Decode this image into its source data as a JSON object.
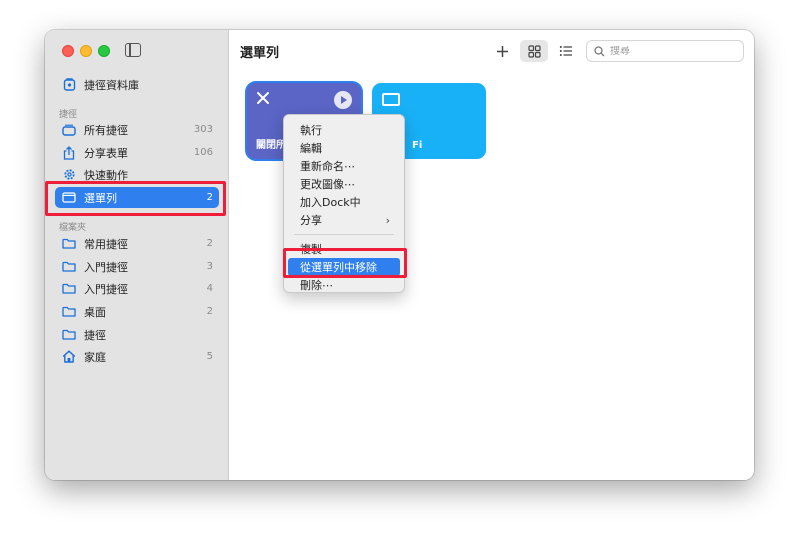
{
  "sidebar": {
    "library": {
      "label": "捷徑資料庫",
      "icon": "library-icon"
    },
    "section_shortcuts": "捷徑",
    "items": [
      {
        "label": "所有捷徑",
        "count": "303",
        "icon": "square-stack-icon"
      },
      {
        "label": "分享表單",
        "count": "106",
        "icon": "share-icon"
      },
      {
        "label": "快速動作",
        "count": "",
        "icon": "gear-icon"
      },
      {
        "label": "選單列",
        "count": "2",
        "icon": "menubar-icon",
        "selected": true
      }
    ],
    "section_folders": "檔案夾",
    "folders": [
      {
        "label": "常用捷徑",
        "count": "2",
        "icon": "folder-icon"
      },
      {
        "label": "入門捷徑",
        "count": "3",
        "icon": "folder-icon"
      },
      {
        "label": "入門捷徑",
        "count": "4",
        "icon": "folder-icon"
      },
      {
        "label": "桌面",
        "count": "2",
        "icon": "folder-icon"
      },
      {
        "label": "捷徑",
        "count": "",
        "icon": "folder-icon"
      },
      {
        "label": "家庭",
        "count": "5",
        "icon": "home-icon"
      }
    ]
  },
  "main": {
    "title": "選單列",
    "search": {
      "placeholder": "搜尋",
      "value": ""
    },
    "tiles": [
      {
        "name": "關閉所",
        "color": "#5a65c5",
        "icon": "close-icon"
      },
      {
        "name": "Fi",
        "color": "#18b1f8",
        "icon": "tv-icon"
      }
    ]
  },
  "context_menu": {
    "items": [
      {
        "label": "執行"
      },
      {
        "label": "編輯"
      },
      {
        "label": "重新命名⋯"
      },
      {
        "label": "更改圖像⋯"
      },
      {
        "label": "加入Dock中"
      },
      {
        "label": "分享",
        "submenu": true
      }
    ],
    "items2": [
      {
        "label": "複製"
      },
      {
        "label": "從選單列中移除",
        "active": true
      },
      {
        "label": "刪除⋯"
      }
    ]
  },
  "colors": {
    "accent": "#2f80ee",
    "highlight_box": "#ee1d3a"
  }
}
